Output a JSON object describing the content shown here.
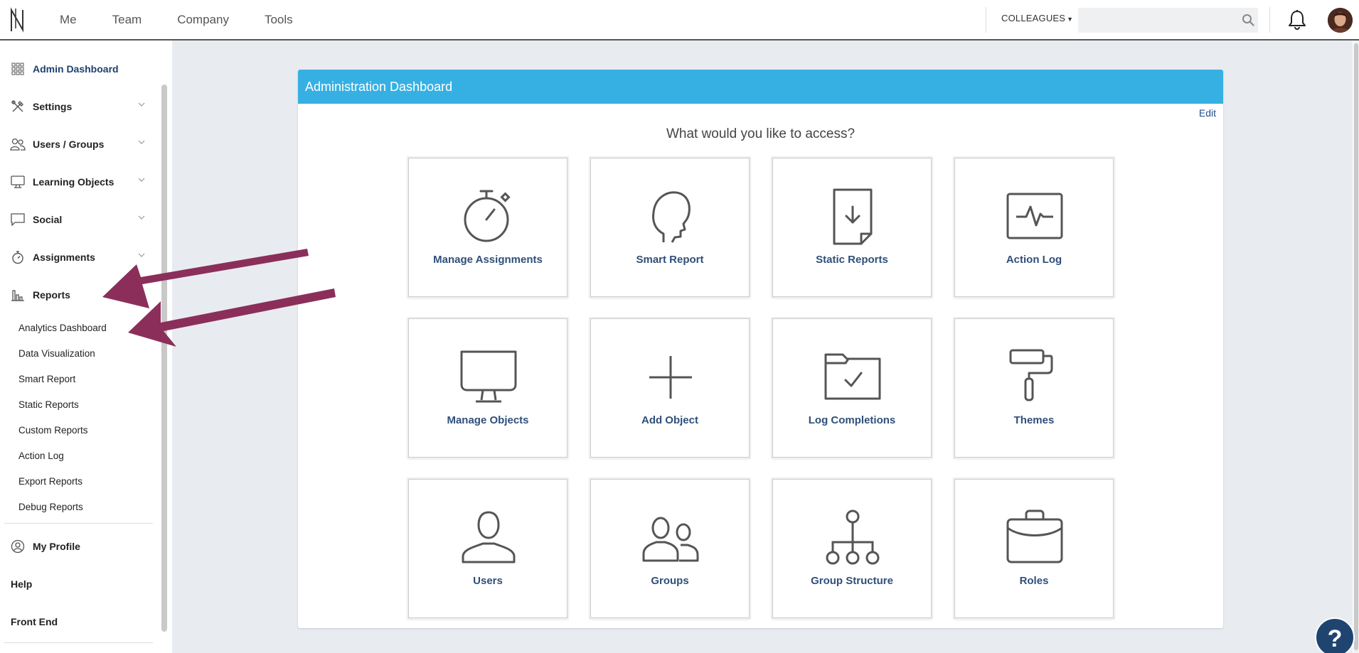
{
  "topbar": {
    "nav": [
      "Me",
      "Team",
      "Company",
      "Tools"
    ],
    "colleagues_label": "COLLEAGUES",
    "search_value": "",
    "search_placeholder": ""
  },
  "sidebar": {
    "items": [
      {
        "label": "Admin Dashboard",
        "icon": "grid-icon",
        "expandable": false
      },
      {
        "label": "Settings",
        "icon": "tools-icon",
        "expandable": true
      },
      {
        "label": "Users / Groups",
        "icon": "users-icon",
        "expandable": true
      },
      {
        "label": "Learning Objects",
        "icon": "monitor-icon",
        "expandable": true
      },
      {
        "label": "Social",
        "icon": "speech-bubble-icon",
        "expandable": true
      },
      {
        "label": "Assignments",
        "icon": "stopwatch-icon",
        "expandable": true
      },
      {
        "label": "Reports",
        "icon": "bar-chart-icon",
        "expandable": false
      }
    ],
    "reports_subitems": [
      "Analytics Dashboard",
      "Data Visualization",
      "Smart Report",
      "Static Reports",
      "Custom Reports",
      "Action Log",
      "Export Reports",
      "Debug Reports"
    ],
    "profile_label": "My Profile",
    "help_label": "Help",
    "frontend_label": "Front End"
  },
  "panel": {
    "title": "Administration Dashboard",
    "edit_label": "Edit",
    "question": "What would you like to access?",
    "tiles": [
      {
        "label": "Manage Assignments",
        "icon": "stopwatch-icon"
      },
      {
        "label": "Smart Report",
        "icon": "head-icon"
      },
      {
        "label": "Static Reports",
        "icon": "document-download-icon"
      },
      {
        "label": "Action Log",
        "icon": "pulse-monitor-icon"
      },
      {
        "label": "Manage Objects",
        "icon": "monitor-icon"
      },
      {
        "label": "Add Object",
        "icon": "plus-icon"
      },
      {
        "label": "Log Completions",
        "icon": "folder-check-icon"
      },
      {
        "label": "Themes",
        "icon": "paint-roller-icon"
      },
      {
        "label": "Users",
        "icon": "user-icon"
      },
      {
        "label": "Groups",
        "icon": "group-icon"
      },
      {
        "label": "Group Structure",
        "icon": "hierarchy-icon"
      },
      {
        "label": "Roles",
        "icon": "briefcase-icon"
      }
    ]
  },
  "help_button_label": "?",
  "colors": {
    "header_blue": "#36b0e3",
    "tile_label": "#2f4f7a",
    "annotation_arrow": "#8b2f5a",
    "help_button": "#1f4470"
  }
}
